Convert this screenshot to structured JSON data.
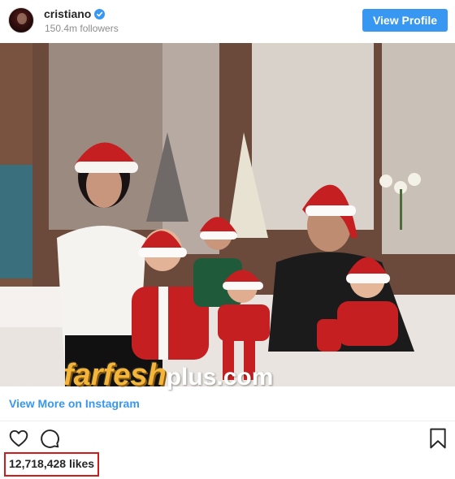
{
  "header": {
    "username": "cristiano",
    "followers": "150.4m followers",
    "view_profile_label": "View Profile"
  },
  "photo": {
    "watermark_main": "farfesh",
    "watermark_suffix": "plus.com"
  },
  "view_more_label": "View More on Instagram",
  "actions": {
    "like_icon": "heart-icon",
    "comment_icon": "comment-icon",
    "save_icon": "bookmark-icon"
  },
  "likes_text": "12,718,428 likes",
  "colors": {
    "accent": "#3897f0",
    "highlight_border": "#d11a1a",
    "text": "#262626",
    "muted": "#8e8e8e"
  }
}
